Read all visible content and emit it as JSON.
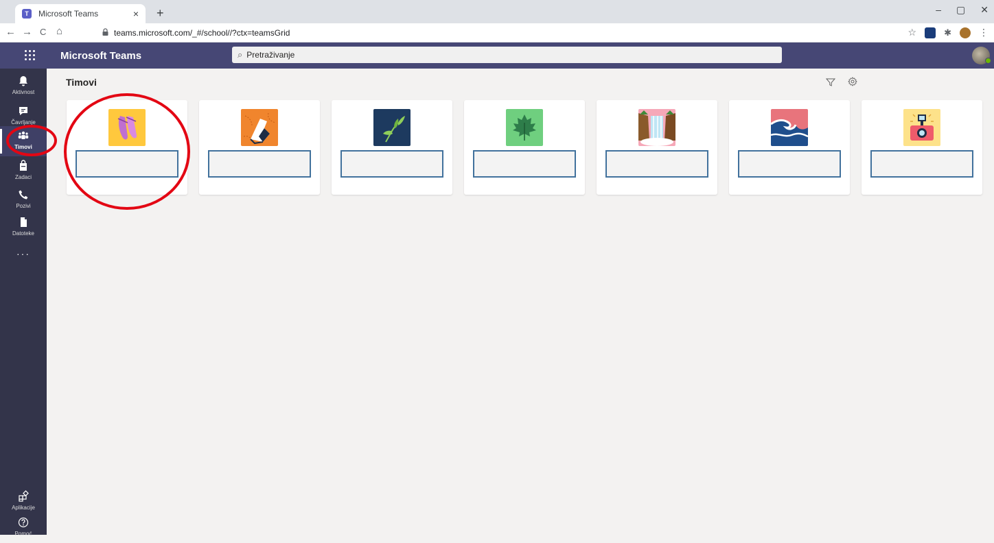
{
  "browser": {
    "tab_title": "Microsoft Teams",
    "tab_close": "×",
    "new_tab": "+",
    "url": "teams.microsoft.com/_#/school//?ctx=teamsGrid",
    "back": "←",
    "forward": "→",
    "reload": "C",
    "home": "⌂",
    "minimize": "–",
    "maximize": "▢",
    "close": "✕",
    "star": "☆",
    "menu": "⋮"
  },
  "header": {
    "app_title": "Microsoft Teams",
    "search_placeholder": "Pretraživanje",
    "search_icon": "⌕"
  },
  "rail": {
    "items": [
      {
        "label": "Aktivnost",
        "icon": "bell-icon"
      },
      {
        "label": "Čavrljanje",
        "icon": "chat-icon"
      },
      {
        "label": "Timovi",
        "icon": "teams-icon"
      },
      {
        "label": "Zadaci",
        "icon": "assignments-icon"
      },
      {
        "label": "Pozivi",
        "icon": "phone-icon"
      },
      {
        "label": "Datoteke",
        "icon": "file-icon"
      }
    ],
    "more": "···",
    "bottom": [
      {
        "label": "Aplikacije",
        "icon": "apps-icon"
      },
      {
        "label": "Pomoć",
        "icon": "help-icon"
      }
    ]
  },
  "main": {
    "title": "Timovi",
    "teams": [
      {
        "name": "",
        "color": "#ffc83d",
        "art": "ballet-shoes"
      },
      {
        "name": "",
        "color": "#f0852d",
        "art": "sneaker"
      },
      {
        "name": "",
        "color": "#1d3a5f",
        "art": "leaves"
      },
      {
        "name": "",
        "color": "#6fcf7f",
        "art": "maple-leaf"
      },
      {
        "name": "",
        "color": "#ffffff",
        "art": "waterfall"
      },
      {
        "name": "",
        "color": "#e8747c",
        "art": "wave"
      },
      {
        "name": "",
        "color": "#fde28a",
        "art": "camera"
      }
    ]
  },
  "colors": {
    "header": "#464775",
    "rail": "#33344a",
    "annotation": "#e30613",
    "name_box_border": "#41719c"
  }
}
